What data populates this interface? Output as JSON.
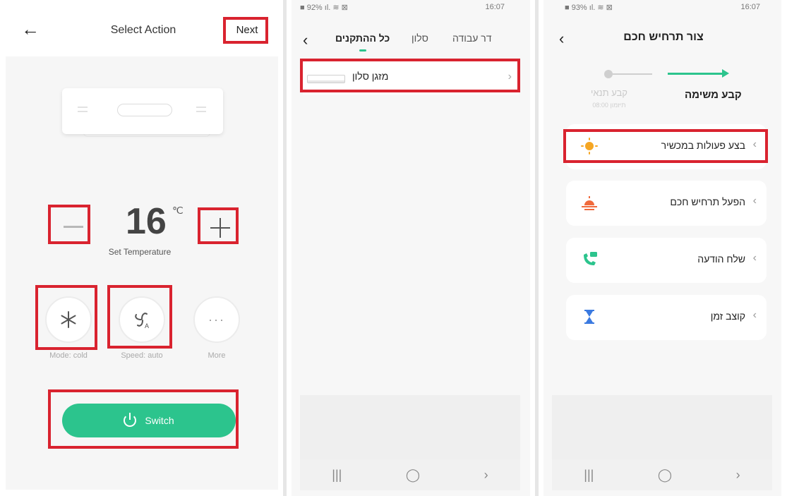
{
  "panel1": {
    "title": "Select Action",
    "next_label": "Next",
    "back_glyph": "←",
    "temperature": "16",
    "temperature_unit": "℃",
    "set_temperature_label": "Set Temperature",
    "mode_label": "Mode: cold",
    "speed_label": "Speed: auto",
    "more_label": "More",
    "more_glyph": "···",
    "switch_label": "Switch"
  },
  "panel2": {
    "status_left": "■ 92% ıl. ≋ ⊠",
    "status_right": "16:07",
    "back_glyph": "‹",
    "tabs": [
      "כל ההתקנים",
      "סלון",
      "דר עבודה"
    ],
    "device_name": "מזגן סלון",
    "chevron": "›",
    "nav": [
      "|||",
      "◯",
      "›"
    ]
  },
  "panel3": {
    "status_left": "■ 93% ıl. ≋ ⊠",
    "status_right": "16:07",
    "back_glyph": "‹",
    "title": "צור תרחיש חכם",
    "step_done": "קבע משימה",
    "step_next": "קבע תנאי",
    "step_sub": "תיזמון 08:00",
    "cards": [
      "בצע פעולות במכשיר",
      "הפעל תרחיש חכם",
      "שלח הודעה",
      "קוצב זמן"
    ],
    "chevron": "‹",
    "nav": [
      "|||",
      "◯",
      "›"
    ]
  },
  "colors": {
    "accent": "#2cc48d",
    "highlight": "#d9232f",
    "sun": "#f5a623",
    "sunset": "#f06a3c",
    "timer": "#3b7ae0"
  }
}
